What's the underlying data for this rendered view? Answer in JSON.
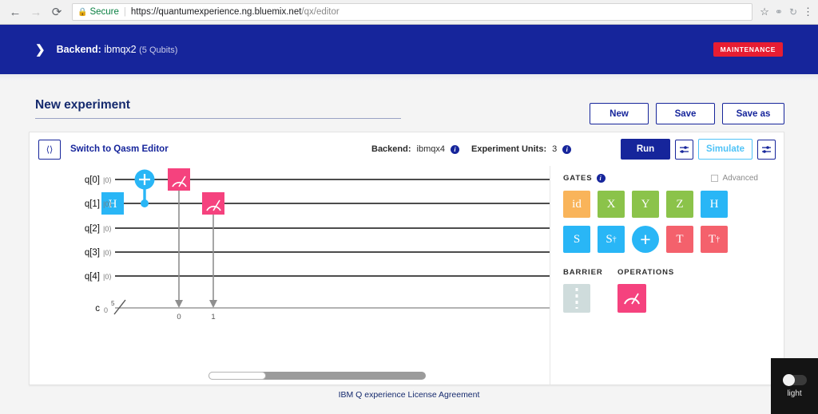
{
  "browser": {
    "back_icon": "back-arrow-icon",
    "forward_icon": "forward-arrow-icon",
    "reload_icon": "reload-icon",
    "secure_label": "Secure",
    "lock_icon": "lock-icon",
    "url_domain": "https://quantumexperience.ng.bluemix.net",
    "url_path": "/qx/editor",
    "star_icon": "bookmark-star-icon",
    "extension_icon": "extension-icon",
    "profile_icon": "profile-icon",
    "menu_icon": "kebab-menu-icon"
  },
  "banner": {
    "chevron_icon": "chevron-right-icon",
    "label": "Backend:",
    "backend_name": "ibmqx2",
    "qubits": "(5 Qubits)",
    "status_badge": "MAINTENANCE",
    "badge_color": "#e71d32",
    "background_color": "#16259b"
  },
  "header": {
    "experiment_title": "New experiment",
    "actions": [
      {
        "label": "New",
        "name": "new-button"
      },
      {
        "label": "Save",
        "name": "save-button"
      },
      {
        "label": "Save as",
        "name": "save-as-button"
      }
    ]
  },
  "toolbar": {
    "qasm_icon": "code-brackets-icon",
    "qasm_label": "Switch to Qasm Editor",
    "backend_label": "Backend:",
    "backend_value": "ibmqx4",
    "units_label": "Experiment Units:",
    "units_value": "3",
    "info_icon": "info-icon",
    "run_label": "Run",
    "simulate_label": "Simulate",
    "run_settings_icon": "sliders-icon",
    "simulate_settings_icon": "sliders-icon",
    "run_color": "#16259b",
    "simulate_color": "#4fc3f7"
  },
  "circuit": {
    "qubits": [
      {
        "label": "q[0]",
        "state": "|0⟩"
      },
      {
        "label": "q[1]",
        "state": "|0⟩"
      },
      {
        "label": "q[2]",
        "state": "|0⟩"
      },
      {
        "label": "q[3]",
        "state": "|0⟩"
      },
      {
        "label": "q[4]",
        "state": "|0⟩"
      }
    ],
    "classical_label": "c",
    "classical_value": "0",
    "classical_width": "5",
    "gates": [
      {
        "name": "hadamard-gate",
        "type": "H",
        "wire": 1,
        "column": 0
      },
      {
        "name": "cnot-target-gate",
        "type": "CNOT-target",
        "wire": 0,
        "column": 1
      },
      {
        "name": "cnot-control-dot",
        "type": "CNOT-control",
        "wire": 1,
        "column": 1
      },
      {
        "name": "measure-gate-q0",
        "type": "measure",
        "wire": 0,
        "column": 2,
        "creg_bit": "0"
      },
      {
        "name": "measure-gate-q1",
        "type": "measure",
        "wire": 1,
        "column": 3,
        "creg_bit": "1"
      }
    ],
    "creg_tick_labels": [
      "0",
      "1"
    ]
  },
  "palette": {
    "gates_heading": "GATES",
    "gates_info_icon": "info-icon",
    "advanced_label": "Advanced",
    "barrier_heading": "BARRIER",
    "operations_heading": "OPERATIONS",
    "barrier_icon": "barrier-icon",
    "measure_icon": "measure-meter-icon",
    "row1": [
      {
        "label": "id",
        "name": "gate-id",
        "color": "#f9b45a"
      },
      {
        "label": "X",
        "name": "gate-x",
        "color": "#8bc34a"
      },
      {
        "label": "Y",
        "name": "gate-y",
        "color": "#8bc34a"
      },
      {
        "label": "Z",
        "name": "gate-z",
        "color": "#8bc34a"
      },
      {
        "label": "H",
        "name": "gate-h",
        "color": "#29b6f6"
      }
    ],
    "row2": [
      {
        "label": "S",
        "dagger": false,
        "name": "gate-s",
        "color": "#29b6f6"
      },
      {
        "label": "S",
        "dagger": true,
        "name": "gate-s-dagger",
        "color": "#29b6f6"
      },
      {
        "label": "+",
        "dagger": false,
        "name": "gate-cnot",
        "color": "#29b6f6",
        "shape": "circle"
      },
      {
        "label": "T",
        "dagger": false,
        "name": "gate-t",
        "color": "#f4616c"
      },
      {
        "label": "T",
        "dagger": true,
        "name": "gate-t-dagger",
        "color": "#f4616c"
      }
    ]
  },
  "footer": {
    "license_link": "IBM Q experience License Agreement"
  },
  "light_widget": {
    "label": "light",
    "toggle_state": "on"
  }
}
